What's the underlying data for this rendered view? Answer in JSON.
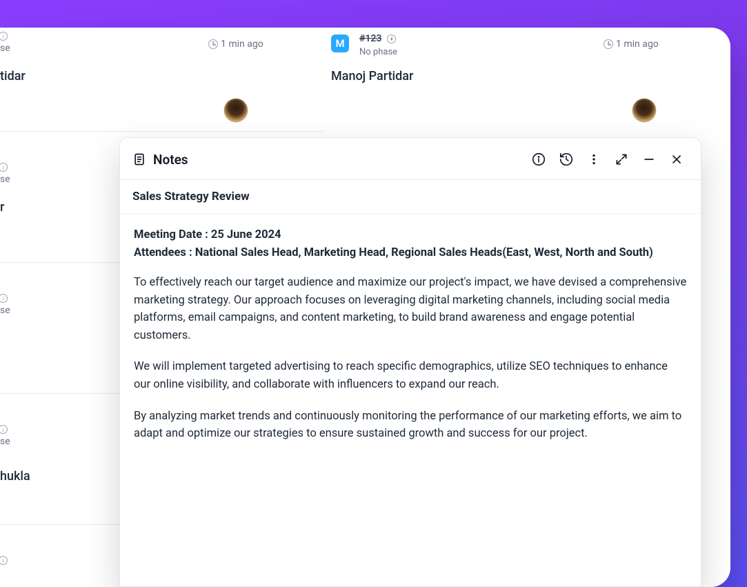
{
  "background": {
    "card1": {
      "phase": "se",
      "time": "1 min ago",
      "name": "tidar"
    },
    "card2": {
      "badge_letter": "M",
      "ticket_id": "#123",
      "phase": "No phase",
      "time": "1 min ago",
      "name": "Manoj Partidar"
    },
    "row_b": {
      "phase": "se",
      "name": "r"
    },
    "row_c": {
      "phase": "se"
    },
    "row_d": {
      "phase": "se",
      "name": "hukla"
    }
  },
  "notes": {
    "panel_title": "Notes",
    "title": "Sales Strategy Review",
    "meeting_date_label": "Meeting Date : ",
    "meeting_date_value": "25 June 2024",
    "attendees_label": "Attendees : ",
    "attendees_value": "National Sales Head,  Marketing Head, Regional Sales Heads(East, West, North and South)",
    "paragraphs": {
      "p1": "To effectively reach our target audience and maximize our project's impact, we have devised a comprehensive marketing strategy. Our approach focuses on leveraging digital marketing channels, including social media platforms, email campaigns, and content marketing, to build brand awareness and engage potential customers.",
      "p2": "We will implement targeted advertising to reach specific demographics, utilize SEO techniques to enhance our online visibility, and collaborate with influencers to expand our reach.",
      "p3": "By analyzing market trends and continuously monitoring the performance of our marketing efforts, we aim to adapt and optimize our strategies to ensure sustained growth and success for our project."
    }
  }
}
